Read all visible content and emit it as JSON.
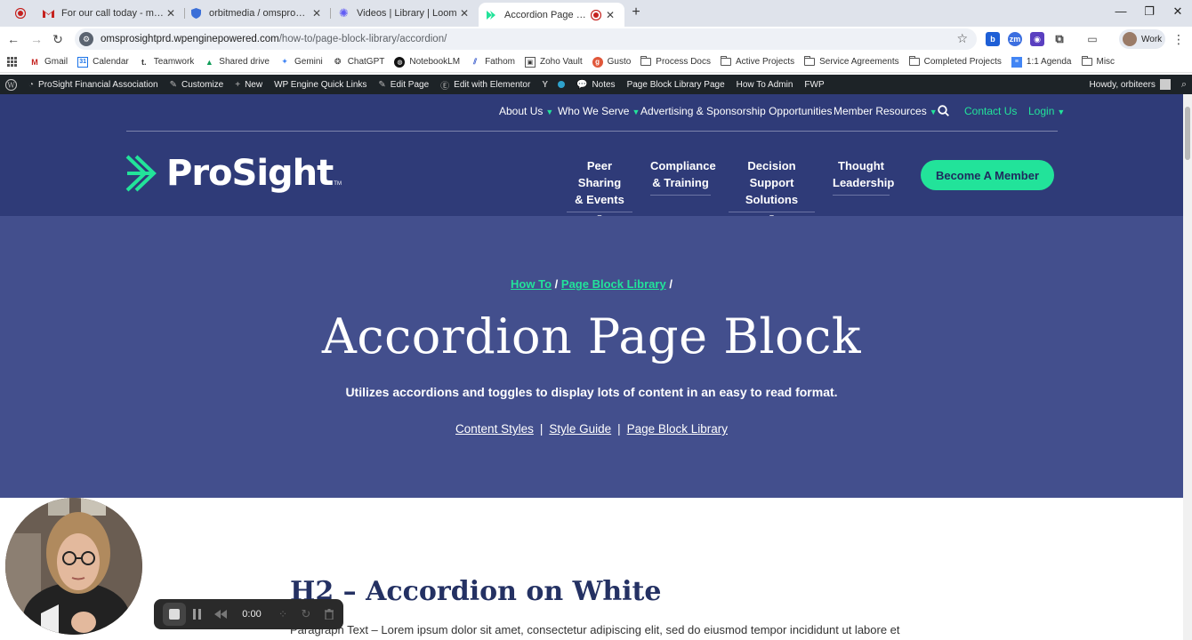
{
  "browser": {
    "tabs": [
      {
        "label": "",
        "icon": "record-icon"
      },
      {
        "label": "For our call today - mandy@or",
        "icon": "gmail-icon"
      },
      {
        "label": "orbitmedia / omsprosightprd –",
        "icon": "shield-icon"
      },
      {
        "label": "Videos | Library | Loom",
        "icon": "loom-icon"
      },
      {
        "label": "Accordion Page Block | Pro",
        "icon": "prosight-icon"
      }
    ],
    "url_host": "omsprosightprd.wpenginepowered.com",
    "url_path": "/how-to/page-block-library/accordion/",
    "profile_label": "Work"
  },
  "bookmarks": [
    {
      "label": "Gmail",
      "icon": "gmail-icon"
    },
    {
      "label": "Calendar",
      "icon": "calendar-icon"
    },
    {
      "label": "Teamwork",
      "icon": "teamwork-icon"
    },
    {
      "label": "Shared drive",
      "icon": "drive-icon"
    },
    {
      "label": "Gemini",
      "icon": "gemini-icon"
    },
    {
      "label": "ChatGPT",
      "icon": "chatgpt-icon"
    },
    {
      "label": "NotebookLM",
      "icon": "notebooklm-icon"
    },
    {
      "label": "Fathom",
      "icon": "fathom-icon"
    },
    {
      "label": "Zoho Vault",
      "icon": "zoho-icon"
    },
    {
      "label": "Gusto",
      "icon": "gusto-icon"
    },
    {
      "label": "Process Docs",
      "icon": "folder-icon"
    },
    {
      "label": "Active Projects",
      "icon": "folder-icon"
    },
    {
      "label": "Service Agreements",
      "icon": "folder-icon"
    },
    {
      "label": "Completed Projects",
      "icon": "folder-icon"
    },
    {
      "label": "1:1 Agenda",
      "icon": "docs-icon"
    },
    {
      "label": "Misc",
      "icon": "folder-icon"
    }
  ],
  "wp_admin": {
    "items": [
      "ProSight Financial Association",
      "Customize",
      "New",
      "WP Engine Quick Links",
      "Edit Page",
      "Edit with Elementor",
      "Notes",
      "Page Block Library Page",
      "How To Admin",
      "FWP"
    ],
    "howdy": "Howdy, orbiteers"
  },
  "site": {
    "top_nav": {
      "about": "About Us",
      "who": "Who We Serve",
      "advertising": "Advertising & Sponsorship Opportunities",
      "member": "Member Resources",
      "contact": "Contact Us",
      "login": "Login"
    },
    "logo_text": "ProSight",
    "logo_tm": "TM",
    "main_nav": {
      "peer_1": "Peer Sharing",
      "peer_2": "& Events",
      "comp_1": "Compliance",
      "comp_2": "& Training",
      "dec_1": "Decision Support",
      "dec_2": "Solutions",
      "th_1": "Thought",
      "th_2": "Leadership"
    },
    "cta": "Become A Member",
    "colors": {
      "navy": "#2f3b78",
      "hero": "#434f8d",
      "accent": "#22e39a"
    }
  },
  "hero": {
    "crumb_1": "How To",
    "crumb_2": "Page Block Library",
    "sep": "/",
    "title": "Accordion Page Block",
    "subtitle": "Utilizes accordions and toggles to display lots of content in an easy to read format.",
    "link_1": "Content Styles",
    "link_2": "Style Guide",
    "link_3": "Page Block Library",
    "pipe": "|"
  },
  "content": {
    "h2": "H2 – Accordion on White",
    "para": "Paragraph Text – Lorem ipsum dolor sit amet, consectetur adipiscing elit, sed do eiusmod tempor incididunt ut labore et"
  },
  "loom": {
    "timer": "0:00"
  }
}
